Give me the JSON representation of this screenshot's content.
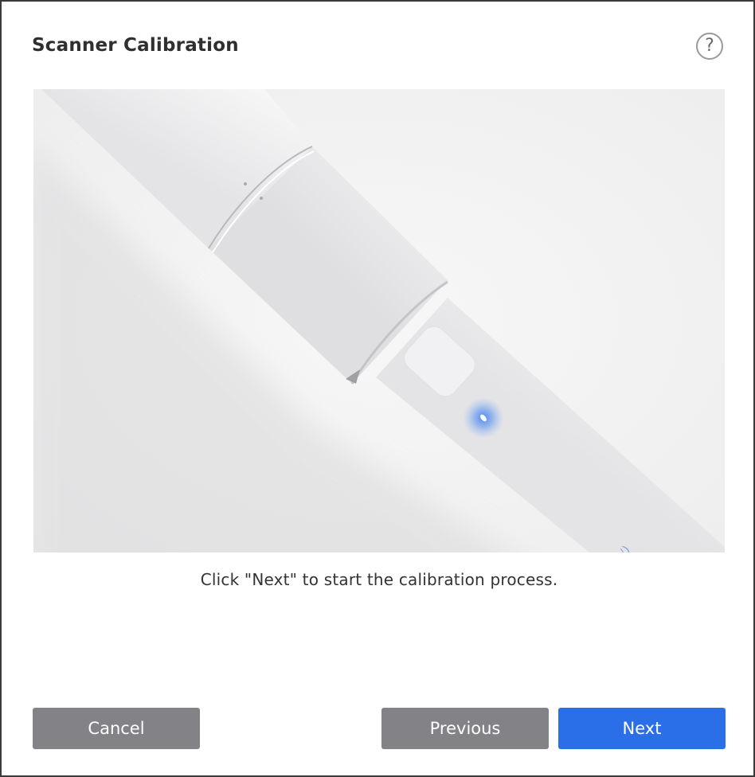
{
  "dialog": {
    "title": "Scanner Calibration",
    "help_icon": "question-circle-icon",
    "help_glyph": "?"
  },
  "illustration": {
    "subject": "handheld-scanner-image",
    "indicator_color": "#3c7df0"
  },
  "instruction": "Click \"Next\" to start the calibration process.",
  "buttons": {
    "cancel": "Cancel",
    "previous": "Previous",
    "next": "Next"
  },
  "colors": {
    "primary": "#2b6fe8",
    "secondary": "#838387"
  }
}
